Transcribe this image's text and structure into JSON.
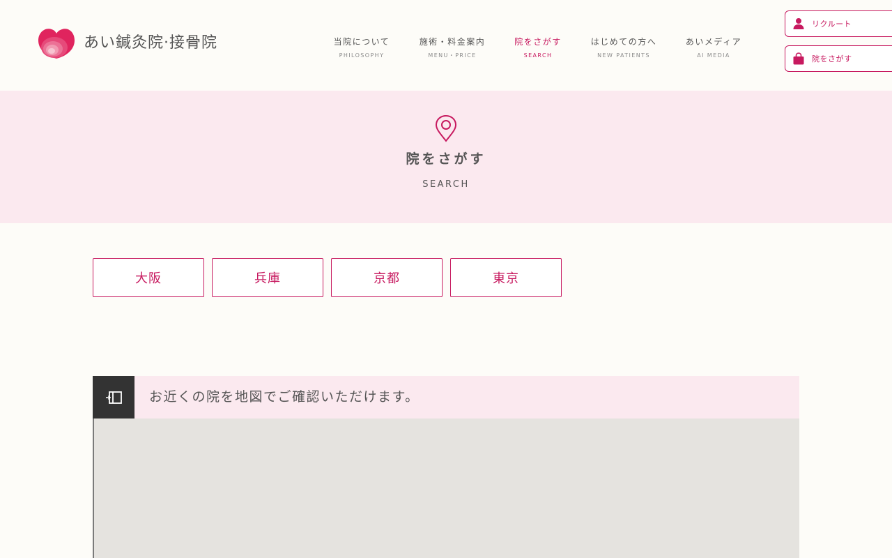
{
  "logo": {
    "text": "あい鍼灸院·接骨院",
    "icon": "heart-logo-icon"
  },
  "nav": [
    {
      "jp": "当院について",
      "en": "PHILOSOPHY"
    },
    {
      "jp": "施術・料金案内",
      "en": "MENU・PRICE"
    },
    {
      "jp": "院をさがす",
      "en": "SEARCH",
      "active": true
    },
    {
      "jp": "はじめての方へ",
      "en": "NEW PATIENTS"
    },
    {
      "jp": "あいメディア",
      "en": "AI MEDIA"
    }
  ],
  "side_buttons": [
    {
      "label": "リクルート",
      "icon": "person-icon"
    },
    {
      "label": "院をさがす",
      "icon": "bag-icon"
    }
  ],
  "hero": {
    "title": "院をさがす",
    "subtitle": "SEARCH",
    "icon": "map-pin-icon"
  },
  "regions": [
    "大阪",
    "兵庫",
    "京都",
    "東京"
  ],
  "map": {
    "caption": "お近くの院を地図でご確認いただけます。",
    "toggle_icon": "sidebar-toggle-icon"
  },
  "colors": {
    "accent": "#c7195f",
    "background": "#fdfcf8",
    "hero_bg": "#fbe9ef",
    "map_bg": "#e5e3df",
    "toggle_bg": "#333333"
  }
}
